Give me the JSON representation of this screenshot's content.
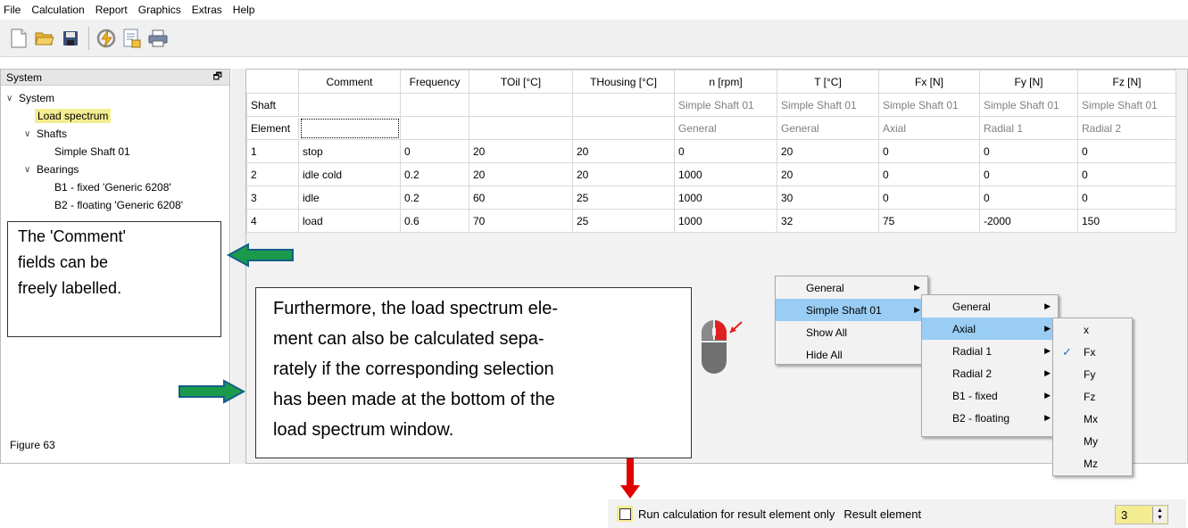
{
  "menubar": {
    "items": [
      "File",
      "Calculation",
      "Report",
      "Graphics",
      "Extras",
      "Help"
    ]
  },
  "toolbar": {
    "icons": [
      "new-file-icon",
      "open-folder-icon",
      "save-icon",
      "calculate-icon",
      "report-icon",
      "print-icon"
    ]
  },
  "sidebar": {
    "title": "System",
    "tree": {
      "root": "System",
      "load_spectrum": "Load spectrum",
      "shafts": "Shafts",
      "shaft1": "Simple Shaft 01",
      "bearings": "Bearings",
      "bearing1": "B1 - fixed 'Generic 6208'",
      "bearing2": "B2 - floating 'Generic 6208'"
    },
    "figure_label": "Figure 63"
  },
  "grid": {
    "headers": [
      "Comment",
      "Frequency",
      "TOil [°C]",
      "THousing [°C]",
      "n [rpm]",
      "T [°C]",
      "Fx [N]",
      "Fy [N]",
      "Fz [N]"
    ],
    "shaft_label": "Shaft",
    "shaft_row": [
      "",
      "",
      "",
      "",
      "Simple Shaft 01",
      "Simple Shaft 01",
      "Simple Shaft 01",
      "Simple Shaft 01",
      "Simple Shaft 01"
    ],
    "element_label": "Element",
    "element_row": [
      "",
      "",
      "",
      "",
      "General",
      "General",
      "Axial",
      "Radial 1",
      "Radial 2"
    ],
    "rows": [
      {
        "id": "1",
        "cells": [
          "stop",
          "0",
          "20",
          "20",
          "0",
          "20",
          "0",
          "0",
          "0"
        ]
      },
      {
        "id": "2",
        "cells": [
          "idle cold",
          "0.2",
          "20",
          "20",
          "1000",
          "20",
          "0",
          "0",
          "0"
        ]
      },
      {
        "id": "3",
        "cells": [
          "idle",
          "0.2",
          "60",
          "25",
          "1000",
          "30",
          "0",
          "0",
          "0"
        ]
      },
      {
        "id": "4",
        "cells": [
          "load",
          "0.6",
          "70",
          "25",
          "1000",
          "32",
          "75",
          "-2000",
          "150"
        ]
      }
    ]
  },
  "annotations": {
    "comment_lines": [
      "The 'Comment'",
      "fields can be",
      "freely labelled."
    ],
    "furthermore_lines": [
      "Furthermore, the load spectrum ele-",
      "ment can also be calculated sepa-",
      "rately if the corresponding selection",
      "has been made at the bottom of the",
      "load spectrum window."
    ]
  },
  "context_menu": {
    "level1": [
      {
        "label": "General",
        "submenu": true
      },
      {
        "label": "Simple Shaft 01",
        "submenu": true,
        "selected": true
      },
      {
        "label": "Show All",
        "submenu": false
      },
      {
        "label": "Hide All",
        "submenu": false
      }
    ],
    "level2": [
      {
        "label": "General",
        "submenu": true
      },
      {
        "label": "Axial",
        "submenu": true,
        "selected": true
      },
      {
        "label": "Radial 1",
        "submenu": true
      },
      {
        "label": "Radial 2",
        "submenu": true
      },
      {
        "label": "B1 - fixed",
        "submenu": true
      },
      {
        "label": "B2 - floating",
        "submenu": true
      }
    ],
    "level3": [
      {
        "label": "x",
        "checked": false
      },
      {
        "label": "Fx",
        "checked": true
      },
      {
        "label": "Fy",
        "checked": false
      },
      {
        "label": "Fz",
        "checked": false
      },
      {
        "label": "Mx",
        "checked": false
      },
      {
        "label": "My",
        "checked": false
      },
      {
        "label": "Mz",
        "checked": false
      }
    ]
  },
  "bottom_bar": {
    "checkbox_label": "Run calculation for result element only",
    "checkbox_checked": false,
    "result_label": "Result element",
    "result_value": "3"
  },
  "colors": {
    "highlight": "#f4ec90",
    "menu_selected": "#99cdf3",
    "green_arrow": "#1a9a4a",
    "red_arrow": "#e00000"
  }
}
